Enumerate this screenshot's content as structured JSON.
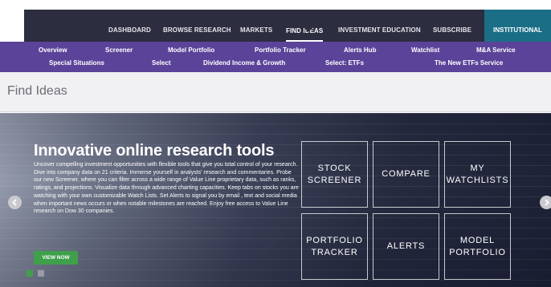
{
  "topnav": {
    "items": [
      {
        "label": "DASHBOARD"
      },
      {
        "label": "BROWSE RESEARCH"
      },
      {
        "label": "MARKETS"
      },
      {
        "label": "FIND IDEAS"
      },
      {
        "label": "INVESTMENT EDUCATION"
      },
      {
        "label": "SUBSCRIBE"
      }
    ],
    "active": "FIND IDEAS",
    "institutional": "INSTITUTIONAL"
  },
  "subnav": {
    "row1": [
      "Overview",
      "Screener",
      "Model Portfolio",
      "Portfolio Tracker",
      "Alerts Hub",
      "Watchlist",
      "M&A Service"
    ],
    "row2": [
      "Special Situations",
      "Select",
      "Dividend Income & Growth",
      "Select: ETFs",
      "The New ETFs Service"
    ]
  },
  "page": {
    "title": "Find Ideas"
  },
  "hero": {
    "title": "Innovative online research tools",
    "body": "Uncover compelling investment opportunities with flexible tools that give you total control of your research. Dive into company data on 21 criteria. Immerse yourself in analysts' research and commentaries. Probe our new Screener, where you can filter across a wide range of Value Line proprietary data, such as ranks, ratings, and projections. Visualize data through advanced charting capacities. Keep tabs on stocks you are watching with your own customizable Watch Lists. Set Alerts to signal you by email , text and social media when important news occurs or when notable milestones are reached. Enjoy free access to Value Line research on Dow 30 companies.",
    "cta": "VIEW NOW",
    "tiles": [
      {
        "label": "STOCK\nSCREENER"
      },
      {
        "label": "COMPARE"
      },
      {
        "label": "MY\nWATCHLISTS"
      },
      {
        "label": "PORTFOLIO\nTRACKER"
      },
      {
        "label": "ALERTS"
      },
      {
        "label": "MODEL\nPORTFOLIO"
      }
    ]
  },
  "colors": {
    "topnav_bg": "#2c2d3f",
    "subnav_bg": "#5b4399",
    "institutional_bg": "#1a6e86",
    "cta_green": "#3f9f4b"
  },
  "icons": {
    "prev": "chevron-left-icon",
    "next": "chevron-right-icon"
  }
}
